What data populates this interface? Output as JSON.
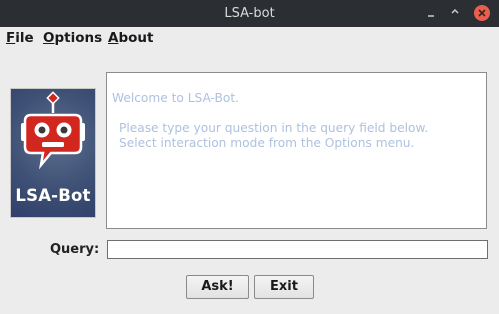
{
  "window": {
    "title": "LSA-bot",
    "controls": [
      "minimize-icon",
      "maximize-icon",
      "close-icon"
    ],
    "close_color": "#ea5e4d"
  },
  "menu": {
    "file": {
      "mnemonic": "F",
      "rest": "ile"
    },
    "options": {
      "mnemonic": "O",
      "rest": "ptions"
    },
    "about": {
      "mnemonic": "A",
      "rest": "bout"
    }
  },
  "logo": {
    "text": "LSA-Bot",
    "icon": "robot-speech-bubble-icon",
    "accent_color": "#d2271f",
    "background_color": "#3e5075"
  },
  "output": {
    "welcome": "Welcome to LSA-Bot.",
    "line1": "Please type your question in the query field below.",
    "line2": "Select interaction mode from the Options menu.",
    "text_color": "#aec2de"
  },
  "query": {
    "label": "Query:",
    "value": ""
  },
  "buttons": {
    "ask": "Ask!",
    "exit": "Exit"
  }
}
